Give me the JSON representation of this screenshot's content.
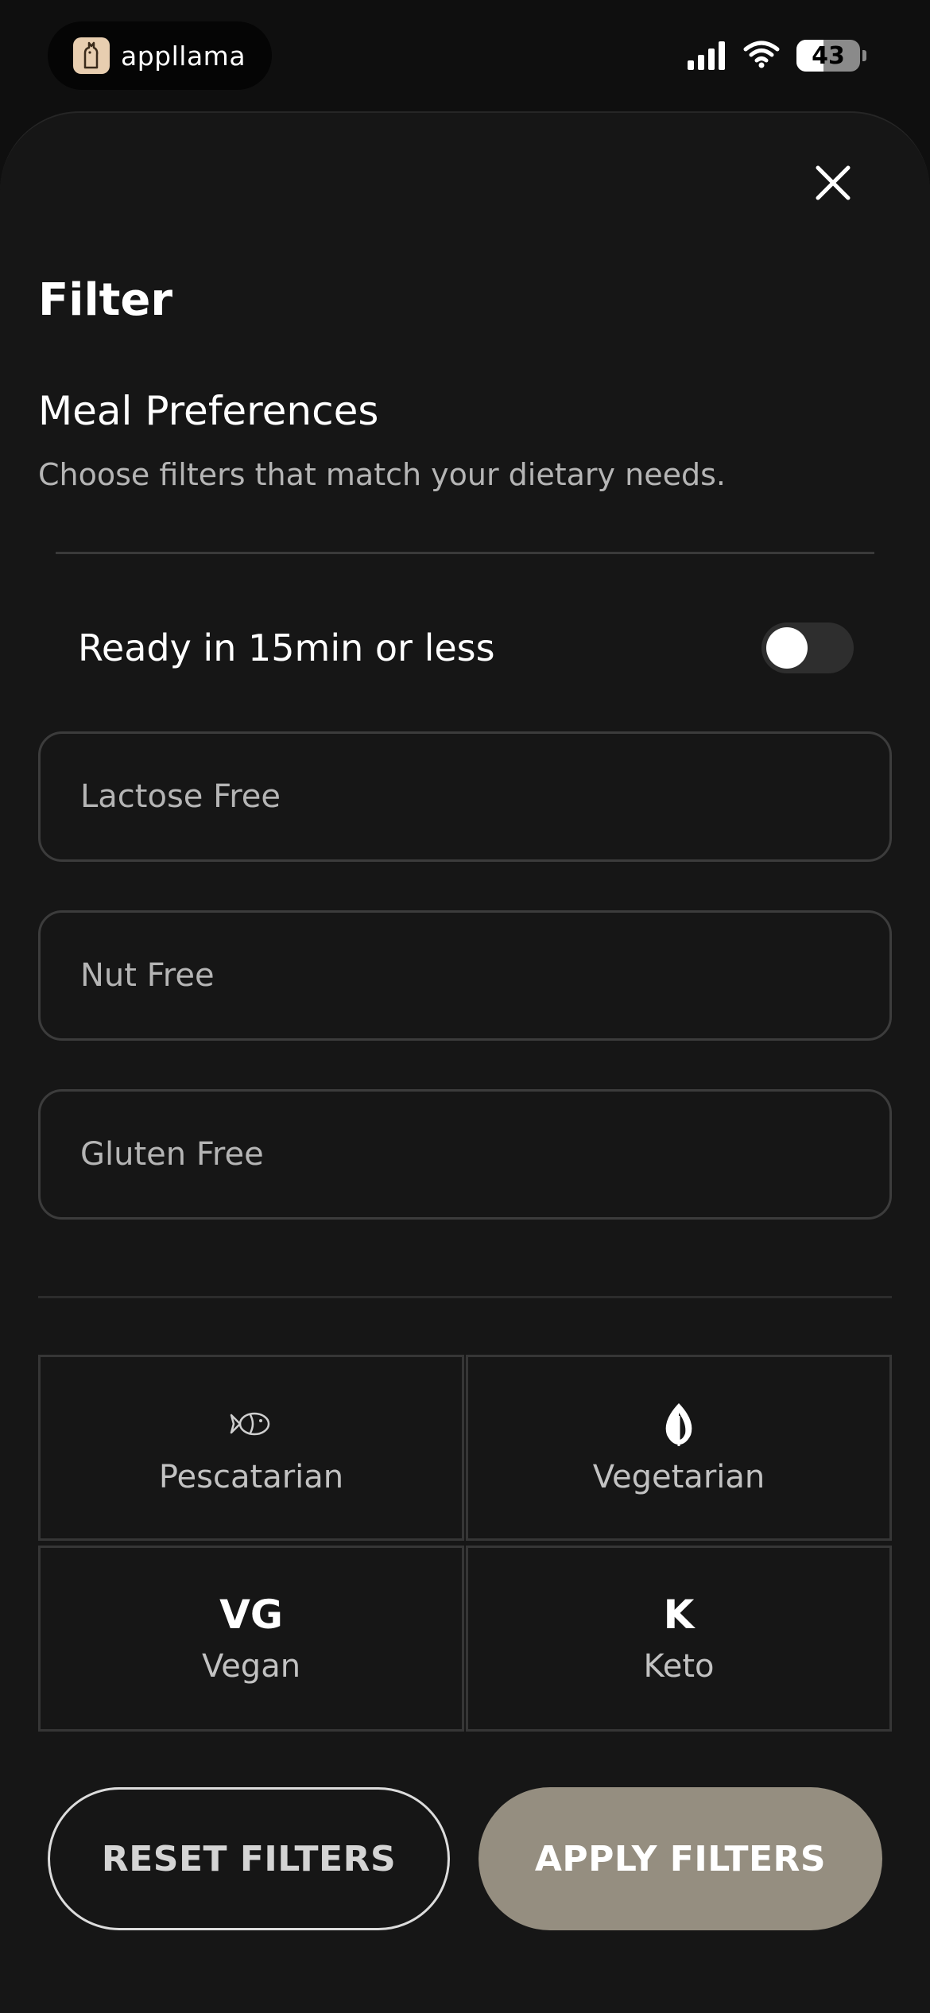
{
  "status_bar": {
    "app_name": "appllama",
    "battery": "43",
    "battery_level": 0.43,
    "icons": [
      "app-logo-icon",
      "signal-icon",
      "wifi-icon",
      "battery-icon"
    ]
  },
  "sheet": {
    "close_icon": "close-icon",
    "title": "Filter",
    "section_title": "Meal Preferences",
    "section_description": "Choose filters that match your dietary needs.",
    "toggle": {
      "label": "Ready in 15min or less",
      "on": false
    },
    "options": [
      {
        "label": "Lactose Free"
      },
      {
        "label": "Nut Free"
      },
      {
        "label": "Gluten Free"
      }
    ],
    "diets": [
      {
        "label": "Pescatarian",
        "icon": "fish-icon"
      },
      {
        "label": "Vegetarian",
        "icon": "leaf-icon"
      },
      {
        "label": "Vegan",
        "abbr": "VG"
      },
      {
        "label": "Keto",
        "abbr": "K"
      }
    ],
    "buttons": {
      "reset": "RESET FILTERS",
      "apply": "APPLY FILTERS"
    }
  },
  "colors": {
    "background": "#161616",
    "apply_button": "#958e80",
    "border": "#3c3c3c"
  }
}
